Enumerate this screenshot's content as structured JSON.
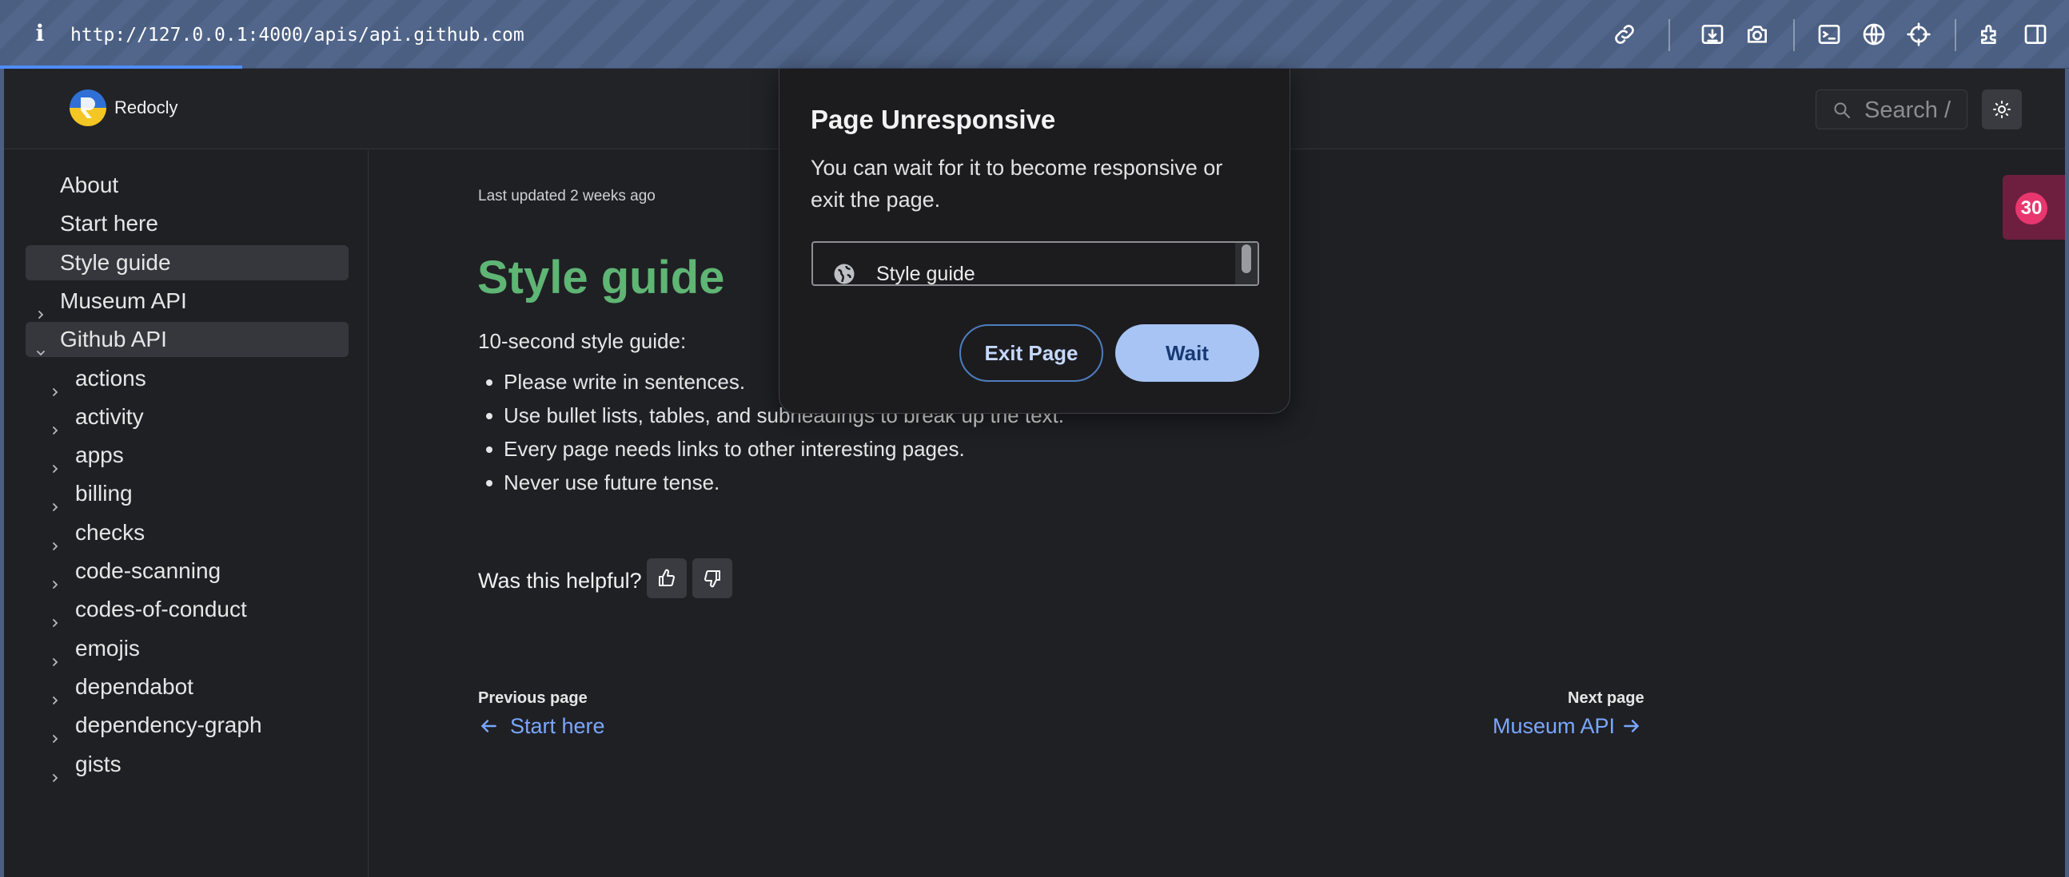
{
  "browser": {
    "url": "http://127.0.0.1:4000/apis/api.github.com",
    "toolbar_icons": [
      "link-icon",
      "download-icon",
      "camera-icon",
      "terminal-icon",
      "globe-icon",
      "crosshair-icon",
      "extensions-icon",
      "sidebar-icon"
    ]
  },
  "header": {
    "logo_text": "Redocly",
    "search_label": "Search",
    "search_shortcut": "/"
  },
  "sidebar": {
    "items": [
      {
        "label": "About",
        "level": 0,
        "expandable": false,
        "active": false
      },
      {
        "label": "Start here",
        "level": 0,
        "expandable": false,
        "active": false
      },
      {
        "label": "Style guide",
        "level": 0,
        "expandable": false,
        "active": true
      },
      {
        "label": "Museum API",
        "level": 0,
        "expandable": true,
        "expanded": false,
        "active": false
      },
      {
        "label": "Github API",
        "level": 0,
        "expandable": true,
        "expanded": true,
        "active": true
      },
      {
        "label": "actions",
        "level": 1,
        "expandable": true
      },
      {
        "label": "activity",
        "level": 1,
        "expandable": true
      },
      {
        "label": "apps",
        "level": 1,
        "expandable": true
      },
      {
        "label": "billing",
        "level": 1,
        "expandable": true
      },
      {
        "label": "checks",
        "level": 1,
        "expandable": true
      },
      {
        "label": "code-scanning",
        "level": 1,
        "expandable": true
      },
      {
        "label": "codes-of-conduct",
        "level": 1,
        "expandable": true
      },
      {
        "label": "emojis",
        "level": 1,
        "expandable": true
      },
      {
        "label": "dependabot",
        "level": 1,
        "expandable": true
      },
      {
        "label": "dependency-graph",
        "level": 1,
        "expandable": true
      },
      {
        "label": "gists",
        "level": 1,
        "expandable": true
      }
    ]
  },
  "main": {
    "last_updated": "Last updated 2 weeks ago",
    "title": "Style guide",
    "intro": "10-second style guide:",
    "bullets": [
      "Please write in sentences.",
      "Use bullet lists, tables, and subheadings to break up the text.",
      "Every page needs links to other interesting pages.",
      "Never use future tense."
    ],
    "helpful_question": "Was this helpful?",
    "prev_caption": "Previous page",
    "prev_link": "Start here",
    "next_caption": "Next page",
    "next_link": "Museum API"
  },
  "badge": {
    "count": "30",
    "color": "#e8376f"
  },
  "dialog": {
    "title": "Page Unresponsive",
    "message": "You can wait for it to become responsive or exit the page.",
    "list_item": "Style guide",
    "exit_label": "Exit Page",
    "wait_label": "Wait"
  },
  "colors": {
    "title_green": "#5fb574",
    "link_blue": "#7aa7ff",
    "wait_button": "#a8c4f5",
    "toolbar": "#4b5f82"
  }
}
